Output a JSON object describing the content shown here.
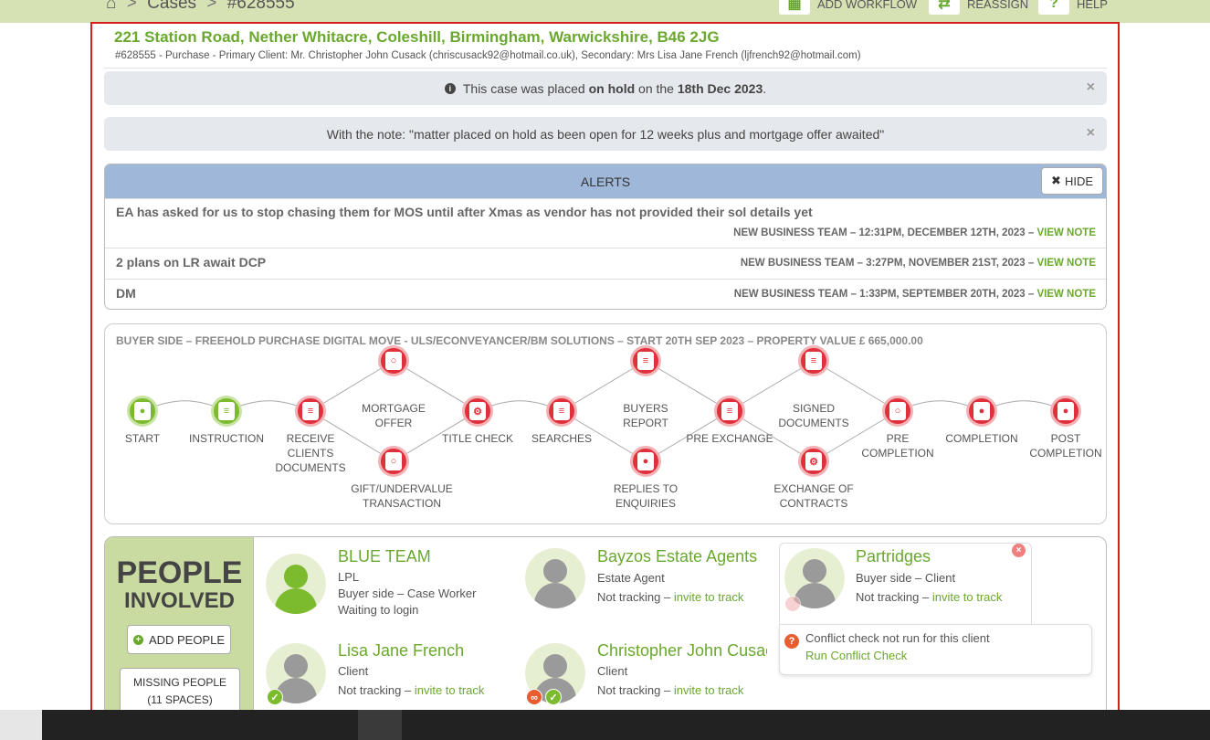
{
  "breadcrumb": {
    "home_icon": "home-icon",
    "cases": "Cases",
    "case_ref": "#628555",
    "separator": ">"
  },
  "toolbar": {
    "add_workflow": "ADD WORKFLOW",
    "reassign": "REASSIGN",
    "help": "HELP"
  },
  "case": {
    "address": "221 Station Road, Nether Whitacre, Coleshill, Birmingham, Warwickshire, B46 2JG",
    "subtitle": "#628555 - Purchase - Primary Client: Mr. Christopher John Cusack (chriscusack92@hotmail.co.uk), Secondary: Mrs Lisa Jane French (ljfrench92@hotmail.com)"
  },
  "banners": {
    "hold_pre": "This case was placed ",
    "hold_bold1": "on hold",
    "hold_mid": " on the ",
    "hold_bold2": "18th Dec 2023",
    "hold_post": ".",
    "note": "With the note: \"matter placed on hold as been open for 12 weeks plus and mortgage offer awaited\"",
    "close": "×"
  },
  "alerts": {
    "title": "ALERTS",
    "hide_label": "HIDE",
    "items": [
      {
        "text": "EA has asked for us to stop chasing them for MOS until after Xmas as vendor has not provided their sol details yet",
        "meta": "NEW BUSINESS TEAM – 12:31PM, DECEMBER 12TH, 2023 – ",
        "link": "VIEW NOTE"
      },
      {
        "text": "2 plans on LR await DCP",
        "meta": "NEW BUSINESS TEAM – 3:27PM, NOVEMBER 21ST, 2023 – ",
        "link": "VIEW NOTE"
      },
      {
        "text": "DM",
        "meta": "NEW BUSINESS TEAM – 1:33PM, SEPTEMBER 20TH, 2023 – ",
        "link": "VIEW NOTE"
      }
    ]
  },
  "workflow": {
    "title": "BUYER SIDE – FREEHOLD PURCHASE DIGITAL MOVE - ULS/ECONVEYANCER/BM SOLUTIONS – START 20TH SEP 2023 – PROPERTY VALUE £ 665,000.00",
    "nodes": [
      {
        "id": "start",
        "l1": "START",
        "l2": "",
        "l3": "",
        "status": "green"
      },
      {
        "id": "instruction",
        "l1": "INSTRUCTION",
        "l2": "",
        "l3": "",
        "status": "green"
      },
      {
        "id": "receive",
        "l1": "RECEIVE",
        "l2": "CLIENTS",
        "l3": "DOCUMENTS",
        "status": "red"
      },
      {
        "id": "mortgage",
        "l1": "MORTGAGE",
        "l2": "OFFER",
        "l3": "",
        "status": "red"
      },
      {
        "id": "gift",
        "l1": "GIFT/UNDERVALUE",
        "l2": "TRANSACTION",
        "l3": "",
        "status": "red"
      },
      {
        "id": "title",
        "l1": "TITLE CHECK",
        "l2": "",
        "l3": "",
        "status": "red"
      },
      {
        "id": "searches",
        "l1": "SEARCHES",
        "l2": "",
        "l3": "",
        "status": "red"
      },
      {
        "id": "buyers",
        "l1": "BUYERS",
        "l2": "REPORT",
        "l3": "",
        "status": "red"
      },
      {
        "id": "replies",
        "l1": "REPLIES TO",
        "l2": "ENQUIRIES",
        "l3": "",
        "status": "red"
      },
      {
        "id": "preex",
        "l1": "PRE EXCHANGE",
        "l2": "",
        "l3": "",
        "status": "red"
      },
      {
        "id": "signed",
        "l1": "SIGNED",
        "l2": "DOCUMENTS",
        "l3": "",
        "status": "red"
      },
      {
        "id": "exchange",
        "l1": "EXCHANGE OF",
        "l2": "CONTRACTS",
        "l3": "",
        "status": "red"
      },
      {
        "id": "precomp",
        "l1": "PRE",
        "l2": "COMPLETION",
        "l3": "",
        "status": "red"
      },
      {
        "id": "completion",
        "l1": "COMPLETION",
        "l2": "",
        "l3": "",
        "status": "red"
      },
      {
        "id": "postcomp",
        "l1": "POST",
        "l2": "COMPLETION",
        "l3": "",
        "status": "red"
      }
    ]
  },
  "people": {
    "title1": "PEOPLE",
    "title2": "INVOLVED",
    "add_label": "ADD PEOPLE",
    "missing1": "MISSING PEOPLE",
    "missing2": "(11 SPACES)",
    "list": [
      {
        "name": "BLUE TEAM",
        "l1": "LPL",
        "l2": "Buyer side – Case Worker",
        "l3": "Waiting to login",
        "link": ""
      },
      {
        "name": "Bayzos Estate Agents",
        "l1": "Estate Agent",
        "l2": "Not tracking – ",
        "l3": "",
        "link": "invite to track"
      },
      {
        "name": "Partridges",
        "l1": "Buyer side – Client",
        "l2": "Not tracking – ",
        "l3": "",
        "link": "invite to track"
      },
      {
        "name": "Lisa Jane French",
        "l1": "Client",
        "l2": "Not tracking – ",
        "l3": "",
        "link": "invite to track"
      },
      {
        "name": "Christopher John Cusack",
        "l1": "Client",
        "l2": "Not tracking – ",
        "l3": "",
        "link": "invite to track"
      }
    ],
    "conflict_text": "Conflict check not run for this client",
    "conflict_link": "Run Conflict Check"
  },
  "colors": {
    "accent": "#6aa82e",
    "alert_header": "#9fb8d9",
    "node_red": "#e0303b",
    "node_green": "#7dbb2e",
    "frame": "#d62020"
  }
}
